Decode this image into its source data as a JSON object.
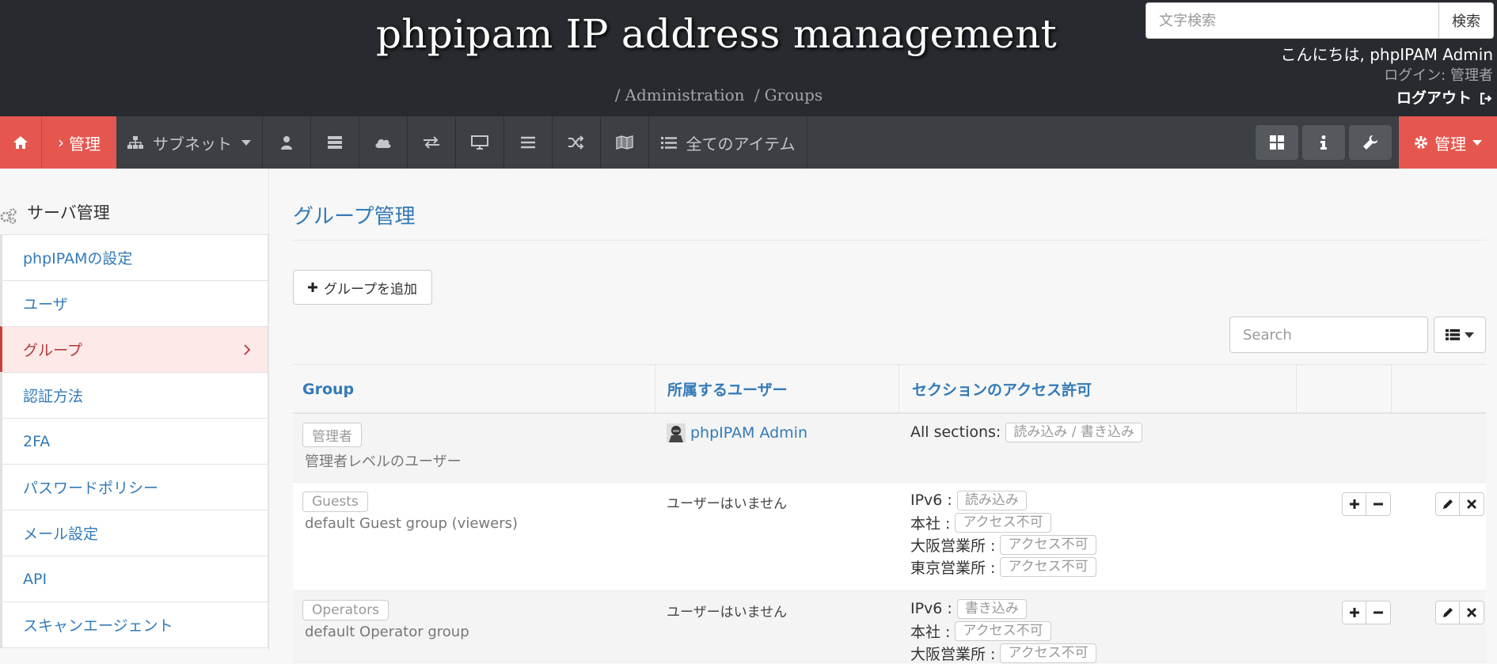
{
  "header": {
    "site_title": "phpipam IP address management",
    "breadcrumb": [
      "Administration",
      "Groups"
    ],
    "search_placeholder": "文字検索",
    "search_button": "検索",
    "greeting": "こんにちは, phpIPAM Admin",
    "login_label": "ログイン:",
    "login_role": "管理者",
    "logout": "ログアウト"
  },
  "nav": {
    "home_icon": "home-icon",
    "admin_label": "管理",
    "subnets_label": "サブネット",
    "icons": [
      "user-icon",
      "server-icon",
      "cloud-icon",
      "exchange-icon",
      "desktop-icon",
      "list-icon",
      "random-icon",
      "map-icon"
    ],
    "all_items_label": "全てのアイテム",
    "right_admin_label": "管理",
    "colors": {
      "accent": "#e5564e",
      "bar": "#3c3f43",
      "header": "#272a2e"
    }
  },
  "sidebar": {
    "heading": "サーバ管理",
    "items": [
      {
        "label": "phpIPAMの設定",
        "active": false
      },
      {
        "label": "ユーザ",
        "active": false
      },
      {
        "label": "グループ",
        "active": true
      },
      {
        "label": "認証方法",
        "active": false
      },
      {
        "label": "2FA",
        "active": false
      },
      {
        "label": "パスワードポリシー",
        "active": false
      },
      {
        "label": "メール設定",
        "active": false
      },
      {
        "label": "API",
        "active": false
      },
      {
        "label": "スキャンエージェント",
        "active": false
      }
    ]
  },
  "main": {
    "title": "グループ管理",
    "add_group_label": "グループを追加",
    "table_search_placeholder": "Search",
    "columns": [
      "Group",
      "所属するユーザー",
      "セクションのアクセス許可"
    ],
    "rows": [
      {
        "group": "管理者",
        "description": "管理者レベルのユーザー",
        "users": "phpIPAM Admin",
        "permissions": [
          {
            "section": "All sections:",
            "access": "読み込み / 書き込み"
          }
        ]
      },
      {
        "group": "Guests",
        "description": "default Guest group (viewers)",
        "users": "ユーザーはいません",
        "permissions": [
          {
            "section": "IPv6 :",
            "access": "読み込み"
          },
          {
            "section": "本社 :",
            "access": "アクセス不可"
          },
          {
            "section": "大阪営業所 :",
            "access": "アクセス不可"
          },
          {
            "section": "東京営業所 :",
            "access": "アクセス不可"
          }
        ]
      },
      {
        "group": "Operators",
        "description": "default Operator group",
        "users": "ユーザーはいません",
        "permissions": [
          {
            "section": "IPv6 :",
            "access": "書き込み"
          },
          {
            "section": "本社 :",
            "access": "アクセス不可"
          },
          {
            "section": "大阪営業所 :",
            "access": "アクセス不可"
          }
        ]
      }
    ]
  }
}
